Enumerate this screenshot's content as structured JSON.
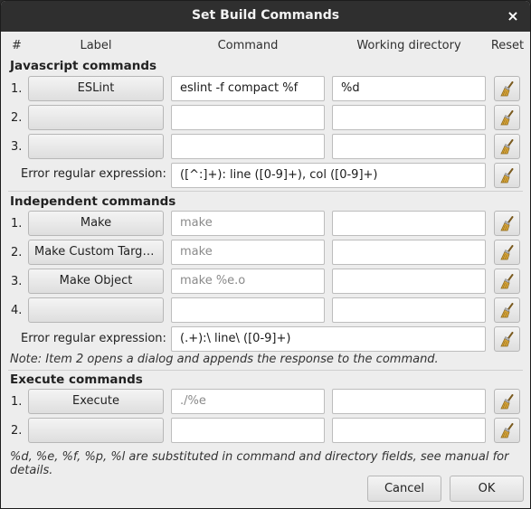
{
  "window": {
    "title": "Set Build Commands",
    "close_glyph": "×"
  },
  "headers": {
    "num": "#",
    "label": "Label",
    "command": "Command",
    "working_directory": "Working directory",
    "reset": "Reset"
  },
  "javascript": {
    "title": "Javascript commands",
    "rows": [
      {
        "num": "1.",
        "label": "ESLint",
        "command": "eslint -f compact %f",
        "directory": "%d"
      },
      {
        "num": "2.",
        "label": "",
        "command": "",
        "directory": ""
      },
      {
        "num": "3.",
        "label": "",
        "command": "",
        "directory": ""
      }
    ],
    "regex_label": "Error regular expression:",
    "regex_value": "([^:]+): line ([0-9]+), col ([0-9]+)"
  },
  "independent": {
    "title": "Independent commands",
    "rows": [
      {
        "num": "1.",
        "label": "Make",
        "command_placeholder": "make",
        "directory": ""
      },
      {
        "num": "2.",
        "label": "Make Custom Target…",
        "command_placeholder": "make",
        "directory": ""
      },
      {
        "num": "3.",
        "label": "Make Object",
        "command_placeholder": "make %e.o",
        "directory": ""
      },
      {
        "num": "4.",
        "label": "",
        "command_placeholder": "",
        "directory": ""
      }
    ],
    "regex_label": "Error regular expression:",
    "regex_value": "(.+):\\ line\\ ([0-9]+)"
  },
  "note": "Note: Item 2 opens a dialog and appends the response to the command.",
  "execute": {
    "title": "Execute commands",
    "rows": [
      {
        "num": "1.",
        "label": "Execute",
        "command_placeholder": "./%e",
        "directory": ""
      },
      {
        "num": "2.",
        "label": "",
        "command_placeholder": "",
        "directory": ""
      }
    ]
  },
  "footer_note": "%d, %e, %f, %p, %l are substituted in command and directory fields, see manual for details.",
  "buttons": {
    "cancel": "Cancel",
    "ok": "OK"
  },
  "icons": {
    "reset": "broom-icon",
    "close": "close-icon"
  },
  "colors": {
    "titlebar": "#2f2f2f",
    "dialog_bg": "#ededed",
    "broom_handle": "#d9a63a"
  }
}
